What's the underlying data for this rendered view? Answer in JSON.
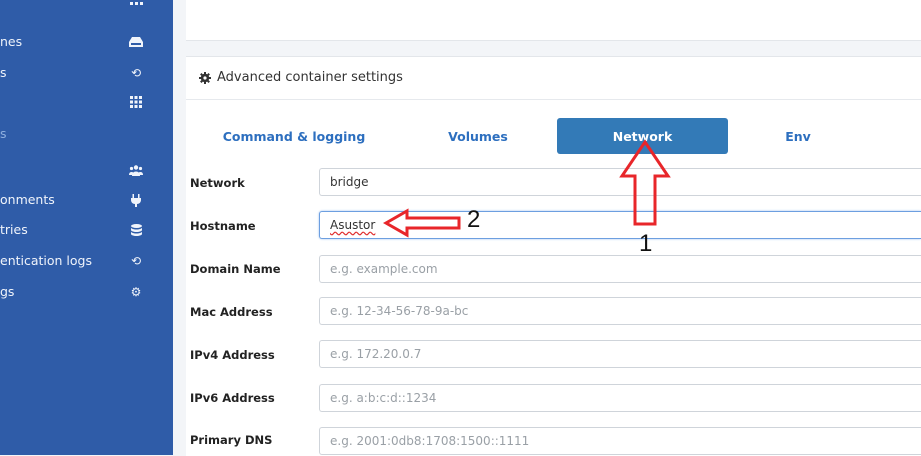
{
  "sidebar": {
    "items": [
      {
        "label": "nes",
        "icon": "drive-icon"
      },
      {
        "label": "s",
        "icon": "history-icon"
      },
      {
        "label": "",
        "icon": "grid-icon"
      },
      {
        "label": "s",
        "icon": ""
      },
      {
        "label": "",
        "icon": "users-icon"
      },
      {
        "label": "onments",
        "icon": "plug-icon"
      },
      {
        "label": "tries",
        "icon": "database-icon"
      },
      {
        "label": "entication logs",
        "icon": "history-icon"
      },
      {
        "label": "gs",
        "icon": "cogs-icon"
      }
    ]
  },
  "panel": {
    "title": "Advanced container settings"
  },
  "tabs": [
    {
      "label": "Command & logging",
      "active": false
    },
    {
      "label": "Volumes",
      "active": false
    },
    {
      "label": "Network",
      "active": true
    },
    {
      "label": "Env",
      "active": false
    }
  ],
  "fields": [
    {
      "label": "Network",
      "value": "bridge",
      "placeholder": ""
    },
    {
      "label": "Hostname",
      "value": "Asustor",
      "placeholder": ""
    },
    {
      "label": "Domain Name",
      "value": "",
      "placeholder": "e.g. example.com"
    },
    {
      "label": "Mac Address",
      "value": "",
      "placeholder": "e.g. 12-34-56-78-9a-bc"
    },
    {
      "label": "IPv4 Address",
      "value": "",
      "placeholder": "e.g. 172.20.0.7"
    },
    {
      "label": "IPv6 Address",
      "value": "",
      "placeholder": "e.g. a:b:c:d::1234"
    },
    {
      "label": "Primary DNS",
      "value": "",
      "placeholder": "e.g. 2001:0db8:1708:1500::1111"
    }
  ],
  "annotations": {
    "arrow_up_number": "1",
    "arrow_left_number": "2",
    "color": "#e8262a"
  },
  "colors": {
    "sidebar_bg": "#2f5ca8",
    "accent": "#337ab7"
  }
}
